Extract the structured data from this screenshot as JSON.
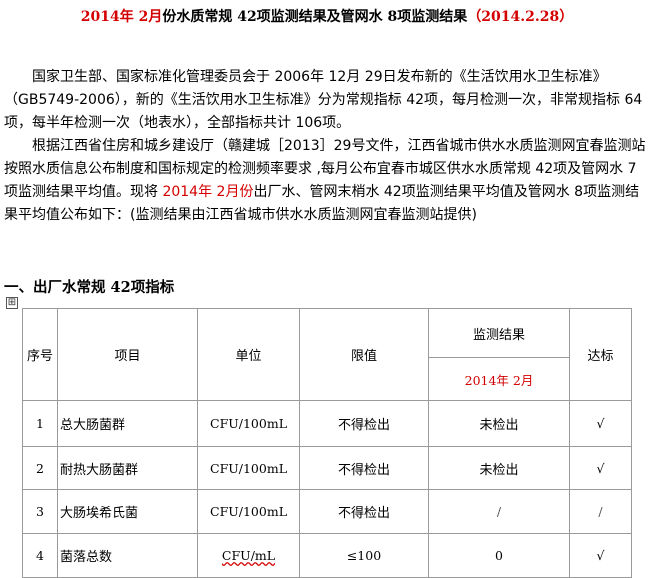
{
  "title": {
    "red_part": "2014年 2月",
    "black_part": "份水质常规 42项监测结果及管网水 8项监测结果",
    "date_part": "（2014.2.28）"
  },
  "intro": {
    "p1": "国家卫生部、国家标准化管理委员会于 2006年 12月 29日发布新的《生活饮用水卫生标准》（GB5749-2006），新的《生活饮用水卫生标准》分为常规指标 42项，每月检测一次，非常规指标 64项，每半年检测一次（地表水），全部指标共计 106项。",
    "p2_before": "根据江西省住房和城乡建设厅（赣建城［2013］29号文件，江西省城市供水水质监测网宜春监测站按照水质信息公布制度和国标规定的检测频率要求 ,每月公布宜春市城区供水水质常规 42项及管网水 7项监测结果平均值。现将 ",
    "p2_red": "2014年 2月份",
    "p2_after": "出厂水、管网末梢水 42项监测结果平均值及管网水 8项监测结果平均值公布如下：(监测结果由江西省城市供水水质监测网宜春监测站提供)"
  },
  "section_title": "一、出厂水常规 42项指标",
  "anchor_glyph": "⊞",
  "table": {
    "headers": {
      "index": "序号",
      "item": "项目",
      "unit": "单位",
      "limit": "限值",
      "result": "监测结果",
      "period": "2014年 2月",
      "pass": "达标"
    },
    "rows": [
      {
        "index": "1",
        "item": "总大肠菌群",
        "unit": "CFU/100mL",
        "limit": "不得检出",
        "result": "未检出",
        "pass": "√"
      },
      {
        "index": "2",
        "item": "耐热大肠菌群",
        "unit": "CFU/100mL",
        "limit": "不得检出",
        "result": "未检出",
        "pass": "√"
      },
      {
        "index": "3",
        "item": "大肠埃希氏菌",
        "unit": "CFU/100mL",
        "limit": "不得检出",
        "result": "/",
        "pass": "/"
      },
      {
        "index": "4",
        "item": "菌落总数",
        "unit": "CFU/mL",
        "limit": "≤100",
        "result": "0",
        "pass": "√"
      }
    ]
  },
  "colors": {
    "accent_red": "#d40000",
    "border": "#9a9a9a"
  }
}
